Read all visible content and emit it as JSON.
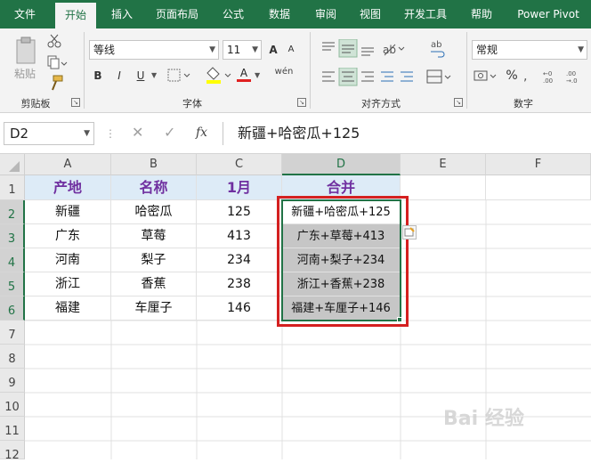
{
  "tabs": [
    "文件",
    "开始",
    "插入",
    "页面布局",
    "公式",
    "数据",
    "审阅",
    "视图",
    "开发工具",
    "帮助",
    "Power Pivot"
  ],
  "active_tab": "开始",
  "ribbon": {
    "clipboard": {
      "label": "剪贴板",
      "paste": "粘贴"
    },
    "font": {
      "label": "字体",
      "family": "等线",
      "size": "11",
      "bold": "B",
      "italic": "I",
      "underline": "U",
      "grow": "A",
      "shrink": "A",
      "color_a": "A",
      "wen": "wén"
    },
    "align": {
      "label": "对齐方式"
    },
    "number": {
      "label": "数字",
      "format": "常规",
      "percent": "%"
    }
  },
  "formula_bar": {
    "name_box": "D2",
    "fx": "fx",
    "formula": "新疆+哈密瓜+125"
  },
  "grid": {
    "columns": [
      "A",
      "B",
      "C",
      "D",
      "E",
      "F"
    ],
    "rows": [
      "1",
      "2",
      "3",
      "4",
      "5",
      "6",
      "7",
      "8",
      "9",
      "10",
      "11",
      "12"
    ],
    "header_row": [
      "产地",
      "名称",
      "1月",
      "合并"
    ],
    "data": [
      [
        "新疆",
        "哈密瓜",
        "125",
        "新疆+哈密瓜+125"
      ],
      [
        "广东",
        "草莓",
        "413",
        "广东+草莓+413"
      ],
      [
        "河南",
        "梨子",
        "234",
        "河南+梨子+234"
      ],
      [
        "浙江",
        "香蕉",
        "238",
        "浙江+香蕉+238"
      ],
      [
        "福建",
        "车厘子",
        "146",
        "福建+车厘子+146"
      ]
    ]
  },
  "watermark": "Bai 经验",
  "colors": {
    "accent": "#217346",
    "header_fill": "#ddebf7",
    "header_text": "#7030a0",
    "highlight_box": "#d42020"
  }
}
